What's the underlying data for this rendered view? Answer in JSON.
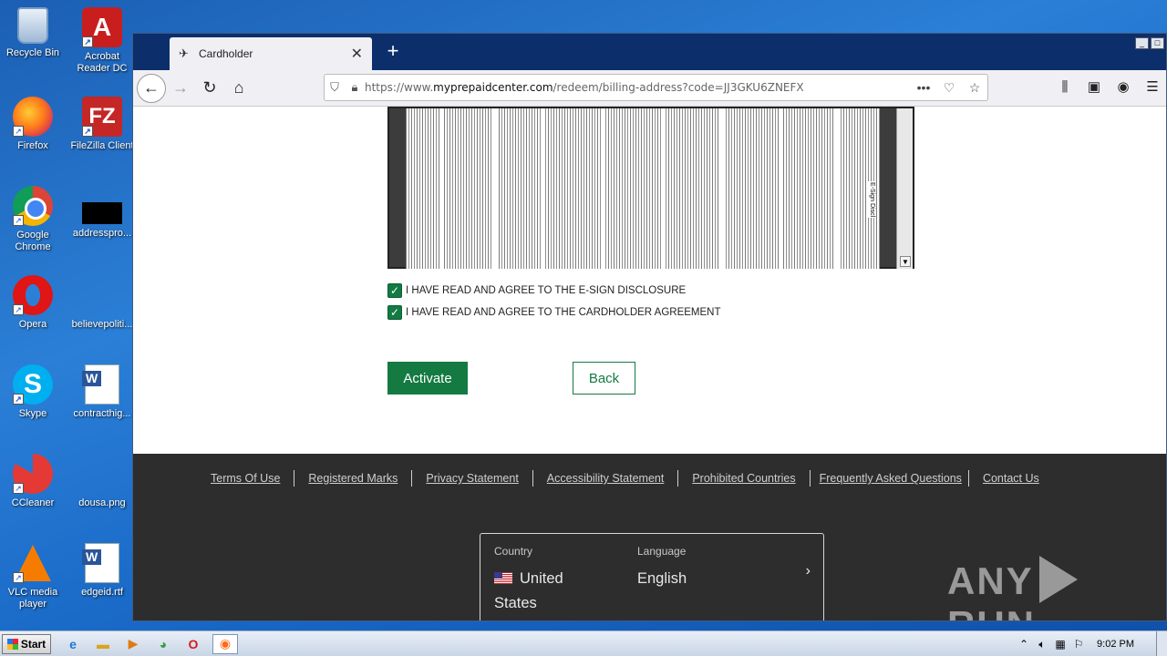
{
  "desktop": {
    "icons": [
      {
        "label": "Recycle Bin"
      },
      {
        "label": "Acrobat Reader DC"
      },
      {
        "label": "Firefox"
      },
      {
        "label": "FileZilla Client"
      },
      {
        "label": "Google Chrome"
      },
      {
        "label": "addresspro..."
      },
      {
        "label": "Opera"
      },
      {
        "label": "believepoliti..."
      },
      {
        "label": "Skype"
      },
      {
        "label": "contracthig..."
      },
      {
        "label": "CCleaner"
      },
      {
        "label": "dousa.png"
      },
      {
        "label": "VLC media player"
      },
      {
        "label": "edgeid.rtf"
      }
    ],
    "acrobat_glyph": "A",
    "filezilla_glyph": "FZ",
    "skype_glyph": "S",
    "word_glyph": "W"
  },
  "browser": {
    "tab_title": "Cardholder",
    "tab_close": "✕",
    "new_tab": "+",
    "url_prefix": "https://www.",
    "url_host": "myprepaidcenter.com",
    "url_path": "/redeem/billing-address?code=JJ3GKU6ZNEFX",
    "icons": {
      "back": "back-arrow-icon",
      "forward": "forward-arrow-icon",
      "reload": "reload-icon",
      "home": "home-icon",
      "shield": "shield-icon",
      "lock": "lock-icon",
      "more": "more-dots-icon",
      "pocket": "pocket-icon",
      "star": "star-icon",
      "library": "library-icon",
      "sidebar": "sidebar-icon",
      "account": "account-icon",
      "menu": "hamburger-menu-icon"
    }
  },
  "page": {
    "doc_heading": "E-Sign Discl",
    "esign_label": "I HAVE READ AND AGREE TO THE E-SIGN DISCLOSURE",
    "cardholder_label": "I HAVE READ AND AGREE TO THE CARDHOLDER AGREEMENT",
    "esign_checked": true,
    "cardholder_checked": true,
    "activate_label": "Activate",
    "back_label": "Back",
    "accent_color": "#147a42"
  },
  "footer": {
    "links": [
      "Terms Of Use",
      "Registered Marks",
      "Privacy Statement",
      "Accessibility Statement",
      "Prohibited Countries",
      "Frequently Asked Questions",
      "Contact Us"
    ],
    "country_label": "Country",
    "country_value_line1": "United",
    "country_value_line2": "States",
    "language_label": "Language",
    "language_value": "English",
    "watermark_left": "ANY",
    "watermark_right": "RUN"
  },
  "taskbar": {
    "start_label": "Start",
    "clock": "9:02 PM"
  }
}
